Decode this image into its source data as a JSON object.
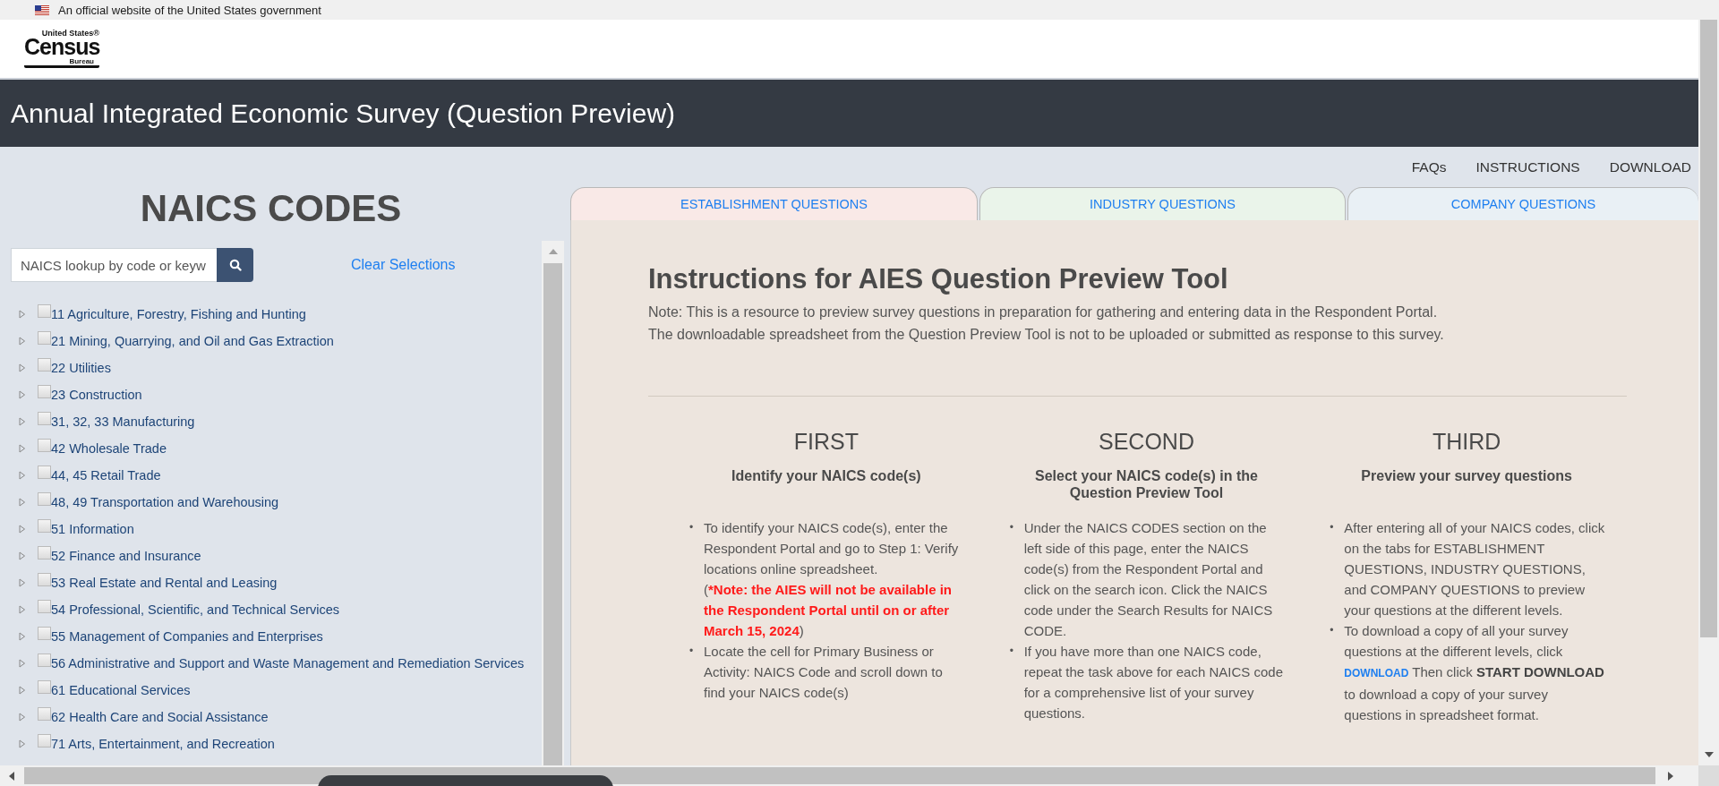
{
  "gov_banner": {
    "text": "An official website of the United States government"
  },
  "logo": {
    "top": "United States®",
    "main": "Census",
    "bottom": "Bureau"
  },
  "page_title": "Annual Integrated Economic Survey (Question Preview)",
  "naics_panel": {
    "heading": "NAICS CODES",
    "search": {
      "placeholder": "NAICS lookup by code or keyw"
    },
    "clear_link": "Clear Selections",
    "tree": [
      {
        "label": "11 Agriculture, Forestry, Fishing and Hunting",
        "checked": false,
        "expanded": false
      },
      {
        "label": "21 Mining, Quarrying, and Oil and Gas Extraction",
        "checked": false,
        "expanded": false
      },
      {
        "label": "22 Utilities",
        "checked": false,
        "expanded": false
      },
      {
        "label": "23 Construction",
        "checked": false,
        "expanded": false
      },
      {
        "label": "31, 32, 33 Manufacturing",
        "checked": false,
        "expanded": false
      },
      {
        "label": "42 Wholesale Trade",
        "checked": false,
        "expanded": false
      },
      {
        "label": "44, 45 Retail Trade",
        "checked": false,
        "expanded": false
      },
      {
        "label": "48, 49 Transportation and Warehousing",
        "checked": false,
        "expanded": false
      },
      {
        "label": "51 Information",
        "checked": false,
        "expanded": false
      },
      {
        "label": "52 Finance and Insurance",
        "checked": false,
        "expanded": false
      },
      {
        "label": "53 Real Estate and Rental and Leasing",
        "checked": false,
        "expanded": false
      },
      {
        "label": "54 Professional, Scientific, and Technical Services",
        "checked": false,
        "expanded": false
      },
      {
        "label": "55 Management of Companies and Enterprises",
        "checked": false,
        "expanded": false
      },
      {
        "label": "56 Administrative and Support and Waste Management and Remediation Services",
        "checked": false,
        "expanded": false
      },
      {
        "label": "61 Educational Services",
        "checked": false,
        "expanded": false
      },
      {
        "label": "62 Health Care and Social Assistance",
        "checked": false,
        "expanded": false
      },
      {
        "label": "71 Arts, Entertainment, and Recreation",
        "checked": false,
        "expanded": false
      }
    ]
  },
  "nav_links": [
    "FAQs",
    "INSTRUCTIONS",
    "DOWNLOAD"
  ],
  "tabs": [
    {
      "label": "ESTABLISHMENT QUESTIONS",
      "selected": false,
      "color": "#f9e9e7"
    },
    {
      "label": "INDUSTRY QUESTIONS",
      "selected": false,
      "color": "#eaf4ea"
    },
    {
      "label": "COMPANY QUESTIONS",
      "selected": false,
      "color": "#e9f0f5"
    }
  ],
  "instructions": {
    "heading": "Instructions for AIES Question Preview Tool",
    "note_lines": [
      "Note: This is a resource to preview survey questions in preparation for gathering and entering data in the Respondent Portal.",
      "The downloadable spreadsheet from the Question Preview Tool is not to be uploaded or submitted as response to this survey."
    ],
    "steps": [
      {
        "title": "FIRST",
        "subtitle": "Identify your NAICS code(s)",
        "bullets": [
          {
            "marker": "•",
            "paragraphs": [
              [
                {
                  "kind": "plain",
                  "text": "To identify your NAICS code(s), enter the Respondent Portal and go to Step 1: Verify locations online spreadsheet."
                }
              ],
              [
                {
                  "kind": "plain",
                  "text": "("
                },
                {
                  "kind": "alert",
                  "text": "*Note: the AIES will not be available in the Respondent Portal until on or after March 15, 2024"
                },
                {
                  "kind": "plain",
                  "text": ")"
                }
              ]
            ]
          },
          {
            "marker": "•",
            "paragraphs": [
              [
                {
                  "kind": "plain",
                  "text": "Locate the cell for Primary Business or Activity: NAICS Code and scroll down to find your NAICS code(s)"
                }
              ]
            ]
          }
        ]
      },
      {
        "title": "SECOND",
        "subtitle": "Select your NAICS code(s) in the Question Preview Tool",
        "bullets": [
          {
            "marker": "•",
            "paragraphs": [
              [
                {
                  "kind": "plain",
                  "text": "Under the NAICS CODES section on the left side of this page, enter the NAICS code(s) from the Respondent Portal and click on the search icon. Click the NAICS code under the Search Results for NAICS CODE."
                }
              ]
            ]
          },
          {
            "marker": "•",
            "paragraphs": [
              [
                {
                  "kind": "plain",
                  "text": "If you have more than one NAICS code, repeat the task above for each NAICS code for a comprehensive list of your survey questions."
                }
              ]
            ]
          }
        ]
      },
      {
        "title": "THIRD",
        "subtitle": "Preview your survey questions",
        "bullets": [
          {
            "marker": "•",
            "paragraphs": [
              [
                {
                  "kind": "plain",
                  "text": "After entering all of your NAICS codes, click on the tabs for ESTABLISHMENT QUESTIONS, INDUSTRY QUESTIONS, and COMPANY QUESTIONS to preview your questions at the different levels."
                }
              ]
            ]
          },
          {
            "marker": "•",
            "paragraphs": [
              [
                {
                  "kind": "plain",
                  "text": "To download a copy of all your survey questions at the different levels, click "
                },
                {
                  "kind": "link",
                  "text": "DOWNLOAD"
                },
                {
                  "kind": "plain",
                  "text": " Then click "
                },
                {
                  "kind": "bold",
                  "text": "START DOWNLOAD"
                },
                {
                  "kind": "plain",
                  "text": " to download a copy of your survey questions in spreadsheet format."
                }
              ]
            ]
          }
        ]
      }
    ]
  }
}
